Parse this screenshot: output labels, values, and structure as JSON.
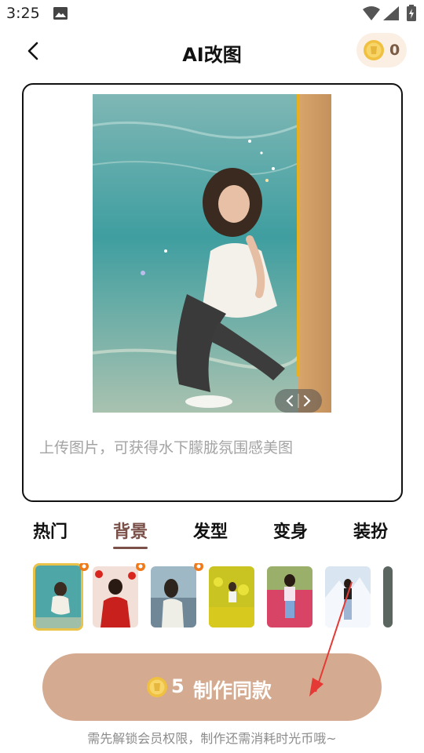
{
  "status_bar": {
    "time": "3:25",
    "icons": [
      "photo-icon",
      "wifi-icon",
      "signal-icon",
      "battery-icon"
    ]
  },
  "header": {
    "back_icon": "chevron-left-icon",
    "title": "AI改图",
    "coin_icon": "coin-icon",
    "coin_balance": "0"
  },
  "preview": {
    "prompt": "上传图片，可获得水下朦胧氛围感美图",
    "compare_icons": [
      "chevron-left-icon",
      "chevron-right-icon"
    ]
  },
  "tabs": [
    {
      "label": "热门",
      "active": false
    },
    {
      "label": "背景",
      "active": true
    },
    {
      "label": "发型",
      "active": false
    },
    {
      "label": "变身",
      "active": false
    },
    {
      "label": "装扮",
      "active": false
    }
  ],
  "templates": [
    {
      "scene": "underwater",
      "selected": true,
      "hot": true
    },
    {
      "scene": "red-festive",
      "selected": false,
      "hot": true
    },
    {
      "scene": "seaside-gulls",
      "selected": false,
      "hot": true
    },
    {
      "scene": "flower-field-yellow",
      "selected": false,
      "hot": false
    },
    {
      "scene": "tulip-field",
      "selected": false,
      "hot": false
    },
    {
      "scene": "snow-mountain",
      "selected": false,
      "hot": false
    },
    {
      "scene": "dark-partial",
      "selected": false,
      "hot": false
    }
  ],
  "cta": {
    "coin_icon": "coin-icon",
    "cost": "5",
    "label": "制作同款"
  },
  "footnote": "需先解锁会员权限，制作还需消耗时光币哦~",
  "colors": {
    "accent_brown": "#7a5048",
    "cta_background": "#d4ab91",
    "coin_pill_background": "#fbeee3",
    "selected_border": "#e9c24a",
    "annotation_arrow": "#e53935"
  }
}
